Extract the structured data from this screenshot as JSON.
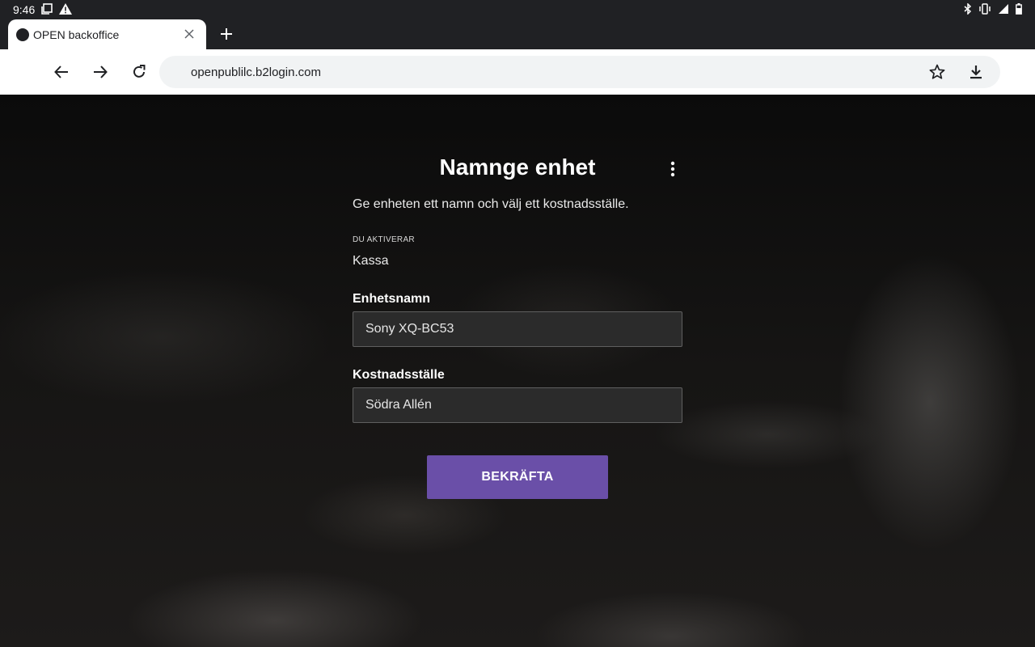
{
  "status_bar": {
    "time": "9:46"
  },
  "browser": {
    "tab_title": "OPEN backoffice",
    "url": "openpublilc.b2login.com"
  },
  "form": {
    "title": "Namnge enhet",
    "subtitle": "Ge enheten ett namn och välj ett kostnadsställe.",
    "activating_label": "DU AKTIVERAR",
    "activating_value": "Kassa",
    "device_name_label": "Enhetsnamn",
    "device_name_value": "Sony XQ-BC53",
    "cost_center_label": "Kostnadsställe",
    "cost_center_value": "Södra Allén",
    "confirm_label": "BEKRÄFTA"
  },
  "colors": {
    "primary_button": "#6a4fa8",
    "browser_dark": "#202124",
    "omnibox_bg": "#f1f3f4"
  },
  "icons": {
    "status_left": [
      "screenshot-icon",
      "warning-icon"
    ],
    "status_right": [
      "bluetooth-icon",
      "vibrate-icon",
      "signal-icon",
      "battery-icon"
    ],
    "toolbar": [
      "back-arrow-icon",
      "forward-arrow-icon",
      "reload-icon",
      "star-icon",
      "download-icon"
    ]
  }
}
